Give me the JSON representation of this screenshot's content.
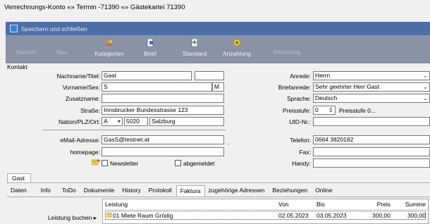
{
  "window": {
    "title": "Verrechnungs-Konto «» Termin -71390 «» Gästekartei 71390"
  },
  "toolbar": {
    "save_label": "Speichern und schließen",
    "buttons": [
      {
        "label": "Suchen",
        "enabled": false
      },
      {
        "label": "Neu",
        "enabled": false
      },
      {
        "label": "Kategorien",
        "enabled": true,
        "icon": "categories-icon"
      },
      {
        "label": "Brief",
        "enabled": true,
        "icon": "letter-icon"
      },
      {
        "label": "Standard",
        "enabled": true,
        "icon": "standard-icon"
      },
      {
        "label": "Anzahlung",
        "enabled": true,
        "icon": "deposit-icon"
      },
      {
        "label": "Rechnung",
        "enabled": false
      }
    ]
  },
  "contact": {
    "group_label": "Kontakt",
    "nachname_label": "Nachname/Titel:",
    "nachname": "Gast",
    "titel": "",
    "vorname_label": "Vorname/Sex:",
    "vorname": "S",
    "sex": "M",
    "zusatz_label": "Zusatzname:",
    "zusatz": "",
    "strasse_label": "Straße:",
    "strasse": "Innsbrucker Bundesstrasse 123",
    "nation_label": "Nation/PLZ/Ort:",
    "nation": "A",
    "plz": "5020",
    "ort": "Salzburg",
    "email_label": "eMail-Adresse:",
    "email": "GasS@testnet.at",
    "homepage_label": "homepage:",
    "homepage": "",
    "newsletter_label": "Newsletter",
    "abgemeldet_label": "abgemeldet",
    "anrede_label": "Anrede:",
    "anrede": "Herrn",
    "briefanrede_label": "Briefanrede:",
    "briefanrede": "Sehr geehrter Herr Gast",
    "sprache_label": "Sprache:",
    "sprache": "Deutsch",
    "preisstufe_label": "Preisstufe:",
    "preisstufe": "0",
    "preisstufe_text": "Preisstufe 0...",
    "uid_label": "UID-Nr.:",
    "uid": "",
    "telefon_label": "Telefon:",
    "telefon": "0664 3820182",
    "fax_label": "Fax:",
    "fax": "",
    "handy_label": "Handy:",
    "handy": ""
  },
  "tabs": {
    "gast": "Gast",
    "subtabs": [
      "Daten",
      "Info",
      "ToDo",
      "Dokumente",
      "History",
      "Protokoll",
      "Faktura",
      "zugehörige Adressen",
      "Beziehungen",
      "Online"
    ],
    "active_subtab": "Faktura"
  },
  "faktura": {
    "leistung_buchen": "Leistung buchen",
    "columns": {
      "leistung": "Leistung",
      "von": "Von",
      "bis": "Bis",
      "preis": "Preis",
      "summe": "Summe"
    },
    "rows": [
      {
        "leistung": "01 Miete Raum Grödig",
        "von": "02.05.2023",
        "bis": "03.05.2023",
        "preis": "300,00",
        "summe": "300,00"
      }
    ]
  }
}
